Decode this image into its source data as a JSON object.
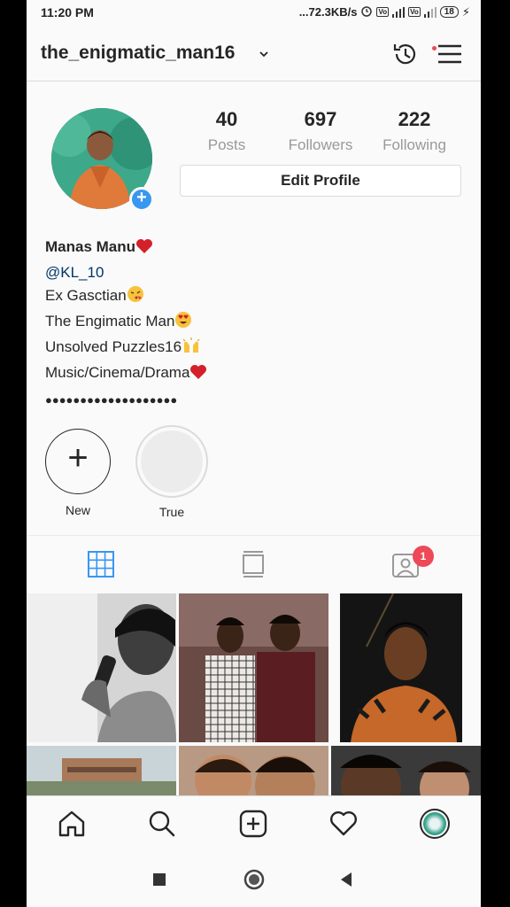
{
  "status_bar": {
    "time": "11:20 PM",
    "network_speed": "...72.3KB/s",
    "battery": "18",
    "icons": [
      "alarm-icon",
      "volte-icon",
      "signal-icon",
      "volte-icon",
      "signal-icon",
      "battery-icon",
      "charging-icon"
    ]
  },
  "header": {
    "username": "the_enigmatic_man16",
    "icons": [
      "chevron-down-icon",
      "archive-history-icon",
      "menu-icon"
    ]
  },
  "profile": {
    "stats": [
      {
        "value": "40",
        "label": "Posts"
      },
      {
        "value": "697",
        "label": "Followers"
      },
      {
        "value": "222",
        "label": "Following"
      }
    ],
    "edit_button": "Edit Profile",
    "bio": {
      "name": "Manas Manu",
      "handle": "@KL_10",
      "line1": "Ex Gasctian",
      "line2": "The Engimatic Man",
      "line3": "Unsolved Puzzles16",
      "line4": "Music/Cinema/Drama",
      "dots": "●●●●●●●●●●●●●●●●●●●"
    }
  },
  "highlights": [
    {
      "label": "New"
    },
    {
      "label": "True"
    }
  ],
  "tabs": {
    "items": [
      "grid-icon",
      "feed-icon",
      "tagged-icon"
    ],
    "tagged_badge": "1"
  },
  "colors": {
    "accent": "#3897f0",
    "badge": "#ed4956",
    "text": "#262626",
    "muted": "#999999"
  },
  "bottom_nav": [
    "home-icon",
    "search-icon",
    "new-post-icon",
    "activity-icon",
    "profile-avatar"
  ],
  "system_nav": [
    "recents-icon",
    "home-circle-icon",
    "back-icon"
  ]
}
